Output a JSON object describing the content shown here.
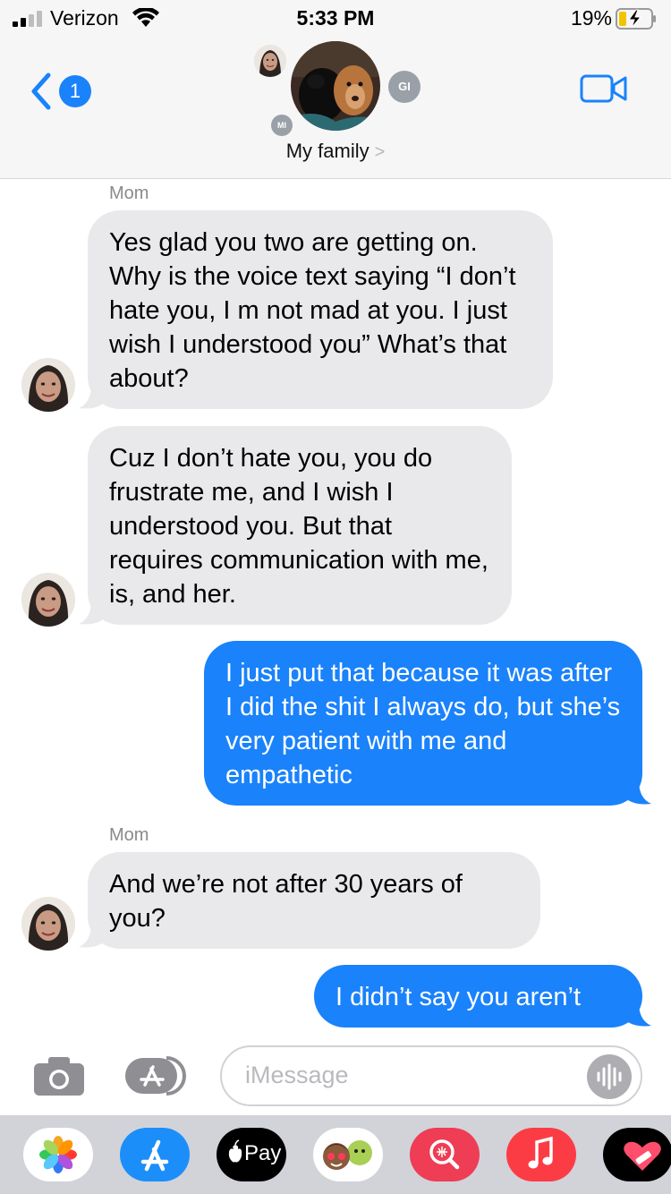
{
  "status_bar": {
    "carrier": "Verizon",
    "time": "5:33 PM",
    "battery_percent": "19%"
  },
  "header": {
    "back_badge": "1",
    "group_name": "My family",
    "chevron": ">",
    "avatar_initials": [
      "GI",
      "MI"
    ]
  },
  "messages": [
    {
      "direction": "incoming",
      "sender": "Mom",
      "text": "Yes glad you two are getting on. Why is the voice text saying “I don’t hate you, I m not mad at you. I just wish I understood you”   What’s that about?"
    },
    {
      "direction": "incoming",
      "sender": "",
      "text": "Cuz I don’t hate you, you do frustrate me, and I wish I understood you. But that requires communication with me, is, and her."
    },
    {
      "direction": "outgoing",
      "text": "I just put that because it was after I did the shit I always do, but she’s very patient with me and empathetic"
    },
    {
      "direction": "incoming",
      "sender": "Mom",
      "text": "And we’re not after 30 years of you?"
    },
    {
      "direction": "outgoing",
      "text": "I didn’t say you aren’t"
    }
  ],
  "input": {
    "placeholder": "iMessage"
  },
  "app_drawer": {
    "apps": [
      "photos-icon",
      "app-store-icon",
      "apple-pay-icon",
      "memoji-icon",
      "image-search-icon",
      "music-icon",
      "heart-sticker-icon"
    ],
    "apple_pay_label": "Pay"
  },
  "colors": {
    "outgoing_bubble": "#1a82fb",
    "incoming_bubble": "#e9e9eb",
    "header_bg": "#f6f6f6",
    "drawer_bg": "#d1d3d9"
  }
}
